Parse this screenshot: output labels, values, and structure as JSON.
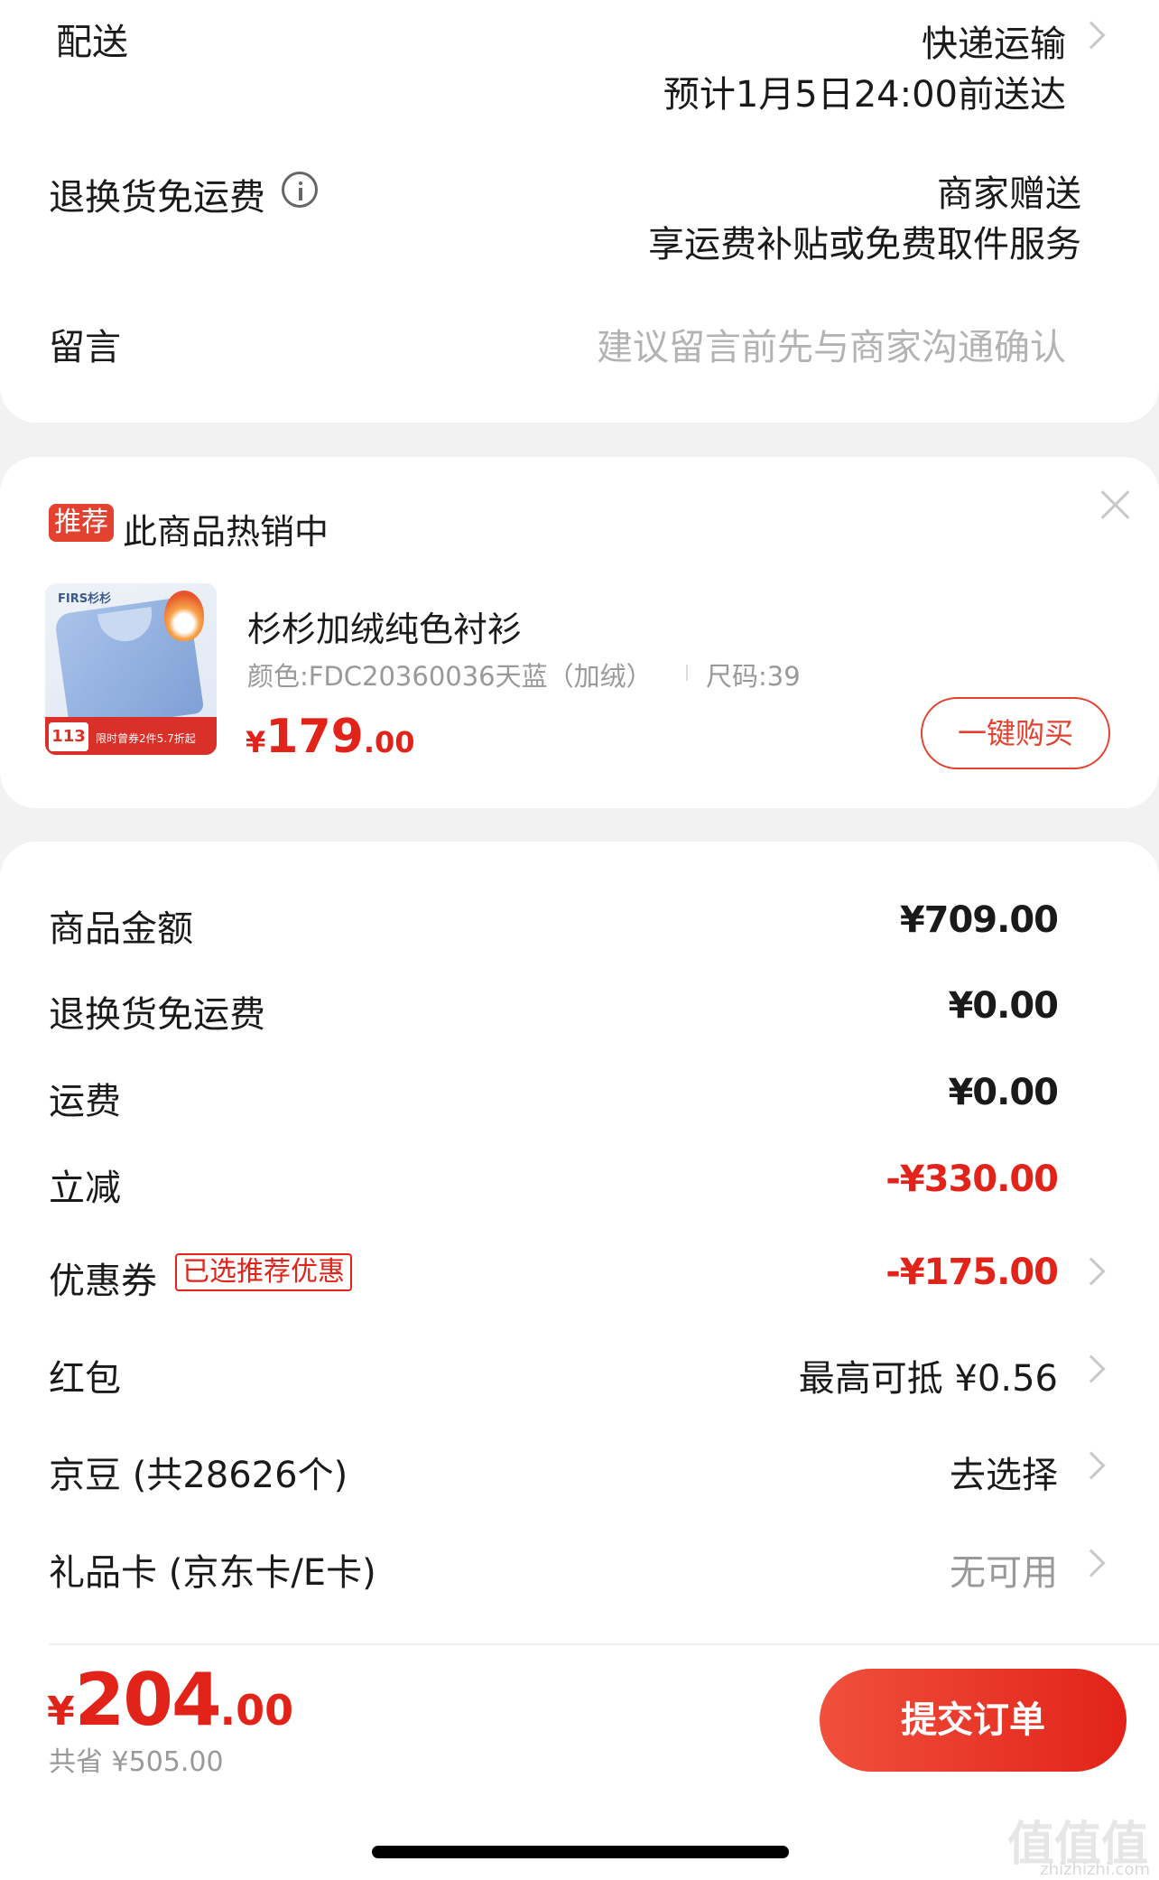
{
  "delivery": {
    "label": "配送",
    "method": "快递运输",
    "eta": "预计1月5日24:00前送达"
  },
  "return_shipping": {
    "label": "退换货免运费",
    "value": "商家赠送",
    "desc": "享运费补贴或免费取件服务"
  },
  "message": {
    "label": "留言",
    "placeholder": "建议留言前先与商家沟通确认"
  },
  "recommend": {
    "tag": "推荐",
    "title": "此商品热销中",
    "product": {
      "name": "杉杉加绒纯色衬衫",
      "spec_color": "颜色:FDC20360036天蓝（加绒）",
      "spec_size": "尺码:39",
      "price_symbol": "¥",
      "price_int": "179",
      "price_dec": ".00",
      "buy_button": "一键购买",
      "thumb_brand": "FIRS杉杉",
      "thumb_badge": "113",
      "thumb_text": "限时曾券2件5.7折起"
    }
  },
  "summary": [
    {
      "label": "商品金额",
      "value": "¥709.00",
      "color": "#1a1a1a"
    },
    {
      "label": "退换货免运费",
      "value": "¥0.00",
      "color": "#1a1a1a"
    },
    {
      "label": "运费",
      "value": "¥0.00",
      "color": "#1a1a1a"
    },
    {
      "label": "立减",
      "value": "-¥330.00",
      "color": "#e2231a"
    }
  ],
  "coupon": {
    "label": "优惠券",
    "tag": "已选推荐优惠",
    "value": "-¥175.00"
  },
  "redpacket": {
    "label": "红包",
    "value": "最高可抵 ¥0.56"
  },
  "jingdou": {
    "label": "京豆 (共28626个)",
    "value": "去选择"
  },
  "giftcard": {
    "label": "礼品卡 (京东卡/E卡)",
    "value": "无可用"
  },
  "footer": {
    "total_symbol": "¥",
    "total_int": "204",
    "total_dec": ".00",
    "saved": "共省 ¥505.00",
    "submit": "提交订单"
  },
  "watermark": {
    "main": "值值值",
    "url": "zhizhizhi.com"
  },
  "colors": {
    "accent": "#e2231a",
    "tag_bg": "#e2422f"
  }
}
